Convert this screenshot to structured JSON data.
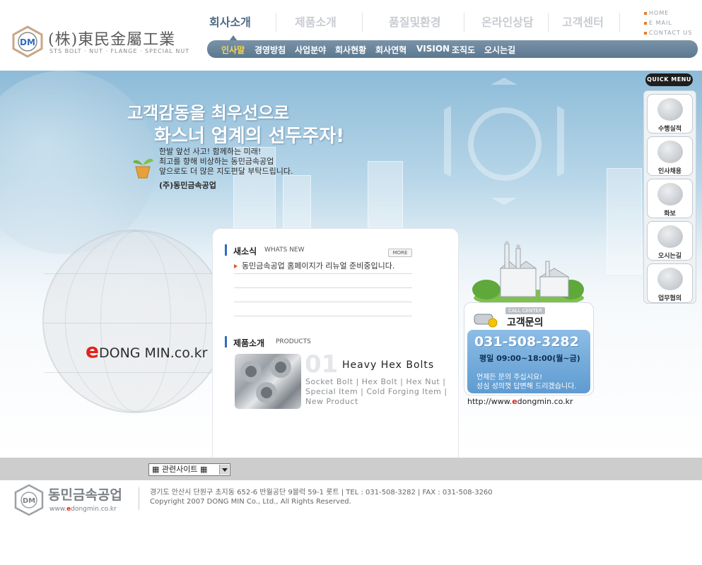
{
  "brand": {
    "name": "(株)東民金屬工業",
    "tagline": "STS BOLT · NUT · FLANGE · SPECIAL NUT",
    "emblem_letters": "DM",
    "accent_color": "#ea7b2b",
    "emblem_color": "#2f6cc0"
  },
  "main_nav": [
    {
      "label": "회사소개",
      "active": true
    },
    {
      "label": "제품소개",
      "active": false
    },
    {
      "label": "품질및환경",
      "active": false
    },
    {
      "label": "온라인상담",
      "active": false
    },
    {
      "label": "고객센터",
      "active": false
    }
  ],
  "util_links": [
    "HOME",
    "E MAIL",
    "CONTACT US"
  ],
  "sub_nav": [
    {
      "label": "인사말",
      "active": true
    },
    {
      "label": "경영방침",
      "active": false
    },
    {
      "label": "사업분야",
      "active": false
    },
    {
      "label": "회사현황",
      "active": false
    },
    {
      "label": "회사연혁",
      "active": false
    },
    {
      "label": "VISION",
      "active": false
    },
    {
      "label": "조직도",
      "active": false
    },
    {
      "label": "오시는길",
      "active": false
    }
  ],
  "hero": {
    "slogan_line1": "고객감동을 최우선으로",
    "slogan_line2": "화스너 업계의 선두주자!",
    "intro_lines": [
      "한발 앞선 사고! 함께하는 미래!",
      "최고를 향해 비상하는 동민금속공업",
      "앞으로도 더 많은 지도편달 부탁드립니다."
    ],
    "signature": "(주)동민금속공업",
    "edongmin_e": "e",
    "edongmin_rest": "DONG MIN.co.kr"
  },
  "news": {
    "title": "새소식",
    "title_en": "WHATS NEW",
    "more_label": "MORE",
    "items": [
      "동민금속공업 홈페이지가 리뉴얼 준비중입니다.",
      "",
      "",
      ""
    ]
  },
  "products": {
    "title": "제품소개",
    "title_en": "PRODUCTS",
    "number": "01",
    "name": "Heavy Hex Bolts",
    "sub_items": "Socket Bolt | Hex Bolt | Hex Nut | Special Item | Cold Forging Item | New Product"
  },
  "call_center": {
    "tag": "CALL CENTER",
    "heading": "고객문의",
    "phone": "031-508-3282",
    "hours": "평일 09:00~18:00(월~금)",
    "msg1": "언제든 문의 주십시요!",
    "msg2": "성심 성의껏 답변해 드리겠습니다.",
    "url_prefix": "http://www.",
    "url_e": "e",
    "url_rest": "dongmin.co.kr"
  },
  "quick_menu": {
    "title": "QUICK MENU",
    "items": [
      {
        "label": "수행실적",
        "icon": "records-icon"
      },
      {
        "label": "인사채용",
        "icon": "recruit-icon"
      },
      {
        "label": "화보",
        "icon": "camera-icon"
      },
      {
        "label": "오시는길",
        "icon": "compass-icon"
      },
      {
        "label": "업무협의",
        "icon": "pen-icon"
      }
    ]
  },
  "footer": {
    "related_sites": "▦ 관련사이트 ▦",
    "logo_name": "동민금속공업",
    "logo_url_prefix": "www.",
    "logo_url_e": "e",
    "logo_url_rest": "dongmin.co.kr",
    "address": "경기도 안산시 단원구 초지동 652-6 반월공단 9블럭 59-1 롯트 | TEL : 031-508-3282 | FAX : 031-508-3260",
    "copyright": "Copyright 2007 DONG MIN Co., Ltd., All Rights Reserved."
  }
}
